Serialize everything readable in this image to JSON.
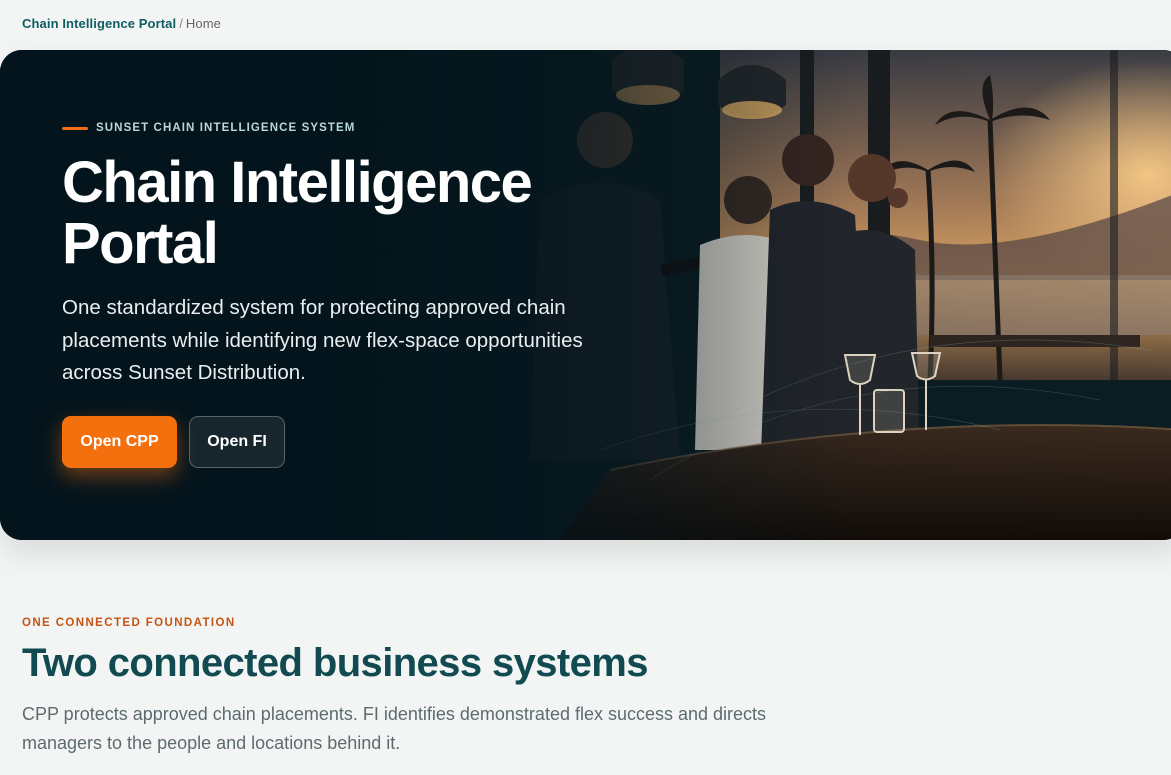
{
  "breadcrumb": {
    "root": "Chain Intelligence Portal",
    "separator": "/",
    "current": "Home"
  },
  "hero": {
    "eyebrow": "SUNSET CHAIN INTELLIGENCE SYSTEM",
    "title_line1": "Chain Intelligence",
    "title_line2": "Portal",
    "description": "One standardized system for protecting approved chain placements while identifying new flex-space opportunities across Sunset Distribution.",
    "primary_button": "Open CPP",
    "secondary_button": "Open FI"
  },
  "section": {
    "eyebrow": "ONE CONNECTED FOUNDATION",
    "title": "Two connected business systems",
    "description": "CPP protects approved chain placements. FI identifies demonstrated flex success and directs managers to the people and locations behind it."
  },
  "colors": {
    "accent": "#f4700f",
    "brand_teal": "#0f5d63",
    "heading_teal": "#114a50",
    "hero_bg": "#061a24"
  }
}
